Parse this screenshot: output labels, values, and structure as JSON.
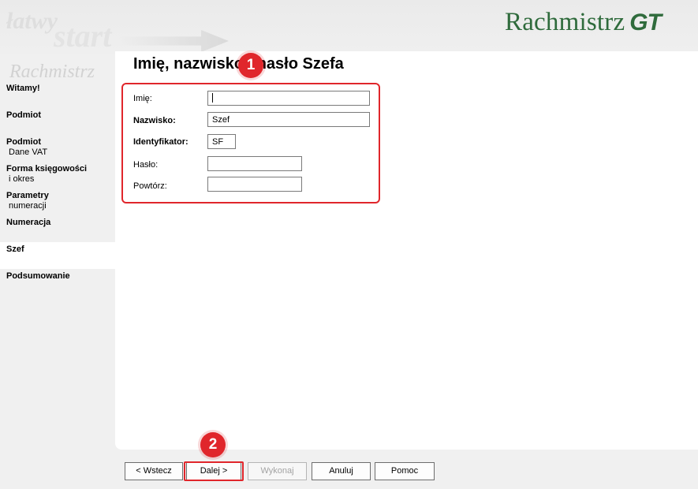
{
  "header": {
    "watermark_top": "łatwy",
    "watermark_start": "start",
    "watermark_brand": "Rachmistrz",
    "logo_text": "Rachmistrz",
    "logo_gt": "GT",
    "brand_color": "#2f6b3c"
  },
  "nav": {
    "items": [
      {
        "label": "Witamy!",
        "sub": ""
      },
      {
        "label": "Podmiot",
        "sub": ""
      },
      {
        "label": "Podmiot",
        "sub": "Dane VAT"
      },
      {
        "label": "Forma księgowości",
        "sub": "i okres"
      },
      {
        "label": "Parametry",
        "sub": "numeracji"
      },
      {
        "label": "Numeracja",
        "sub": ""
      },
      {
        "label": "Szef",
        "sub": ""
      },
      {
        "label": "Podsumowanie",
        "sub": ""
      }
    ],
    "active": "Szef"
  },
  "main": {
    "title": "Imię, nazwisko i hasło Szefa"
  },
  "form": {
    "imie": {
      "label": "Imię:",
      "value": ""
    },
    "nazwisko": {
      "label": "Nazwisko:",
      "value": "Szef"
    },
    "identyfikator": {
      "label": "Identyfikator:",
      "value": "SF"
    },
    "haslo": {
      "label": "Hasło:",
      "value": ""
    },
    "powtorz": {
      "label": "Powtórz:",
      "value": ""
    }
  },
  "annotations": {
    "badge1": "1",
    "badge2": "2",
    "highlight_color": "#e0262b"
  },
  "buttons": {
    "back": "< Wstecz",
    "next": "Dalej >",
    "execute": "Wykonaj",
    "cancel": "Anuluj",
    "help": "Pomoc"
  }
}
